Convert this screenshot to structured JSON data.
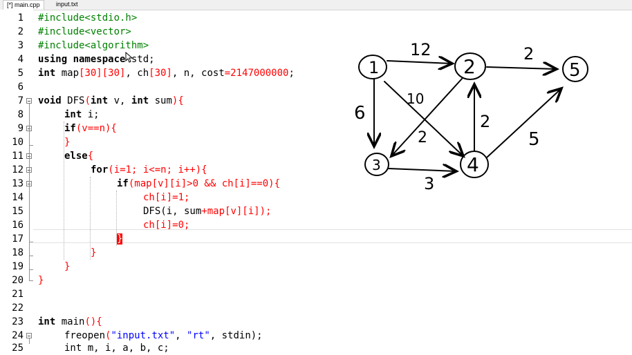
{
  "tabs": [
    {
      "label": "[*] main.cpp",
      "active": true
    },
    {
      "label": "input.txt",
      "active": false
    }
  ],
  "line_numbers": [
    "1",
    "2",
    "3",
    "4",
    "5",
    "6",
    "7",
    "8",
    "9",
    "10",
    "11",
    "12",
    "13",
    "14",
    "15",
    "16",
    "17",
    "18",
    "19",
    "20",
    "21",
    "22",
    "23",
    "24",
    "25"
  ],
  "code": {
    "l1": "#include<stdio.h>",
    "l2": "#include<vector>",
    "l3": "#include<algorithm>",
    "l4a": "using namespace",
    "l4b": " std;",
    "l5a": "int",
    "l5b": " map",
    "l5c": "[30][30]",
    "l5d": ", ch",
    "l5e": "[30]",
    "l5f": ", n, cost",
    "l5g": "=2147000000",
    "l5h": ";",
    "l7a": "void",
    "l7b": " DFS",
    "l7c": "(",
    "l7d": "int",
    "l7e": " v, ",
    "l7f": "int",
    "l7g": " sum",
    "l7h": "){",
    "l8a": "int",
    "l8b": " i;",
    "l9a": "if",
    "l9b": "(v==n){",
    "l10": "}",
    "l11a": "else",
    "l11b": "{",
    "l12a": "for",
    "l12b": "(i=1; i<=n; i++){",
    "l13a": "if",
    "l13b": "(map[v][i]>0 && ch[i]==0){",
    "l14": "ch[i]=1;",
    "l15a": "DFS(i, sum",
    "l15b": "+map[v][i]);",
    "l16": "ch[i]=0;",
    "l17": "}",
    "l18": "}",
    "l19": "}",
    "l20": "}",
    "l23a": "int",
    "l23b": " main",
    "l23c": "(){",
    "l24a": "freopen",
    "l24b": "(",
    "l24c": "\"input.txt\"",
    "l24d": ", ",
    "l24e": "\"rt\"",
    "l24f": ", stdin);",
    "l25": "int m, i, a, b, c;"
  },
  "graph": {
    "nodes": [
      "1",
      "2",
      "3",
      "4",
      "5"
    ],
    "edge_weights": [
      "12",
      "2",
      "10",
      "6",
      "2",
      "2",
      "3",
      "5"
    ]
  }
}
